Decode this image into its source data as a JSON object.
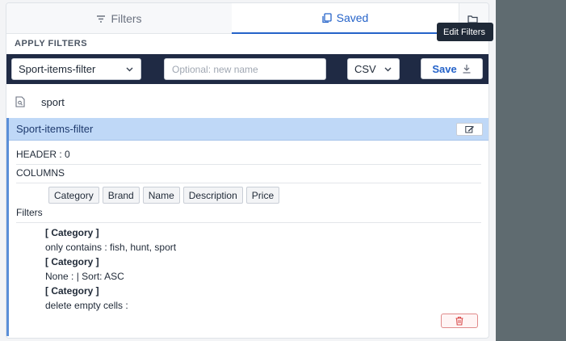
{
  "tabs": {
    "filters_label": "Filters",
    "saved_label": "Saved"
  },
  "apply": {
    "title": "APPLY FILTERS",
    "filter_select_value": "Sport-items-filter",
    "name_placeholder": "Optional: new name",
    "format_value": "CSV",
    "save_label": "Save"
  },
  "sport_item": {
    "label": "sport"
  },
  "card": {
    "title": "Sport-items-filter",
    "tooltip": "Edit Filters",
    "header_line": "HEADER : 0",
    "columns_label": "COLUMNS",
    "columns": [
      "Category",
      "Brand",
      "Name",
      "Description",
      "Price"
    ],
    "filters_label": "Filters",
    "filter_lines": [
      "[ Category ]",
      "only contains : fish, hunt, sport",
      "[ Category ]",
      "None : | Sort: ASC",
      "[ Category ]",
      "delete empty cells :"
    ]
  },
  "colors": {
    "accent": "#2563c9",
    "toolbar_bg": "#1f2a44",
    "card_header_bg": "#bfd8f7",
    "delete": "#d94a4a"
  }
}
